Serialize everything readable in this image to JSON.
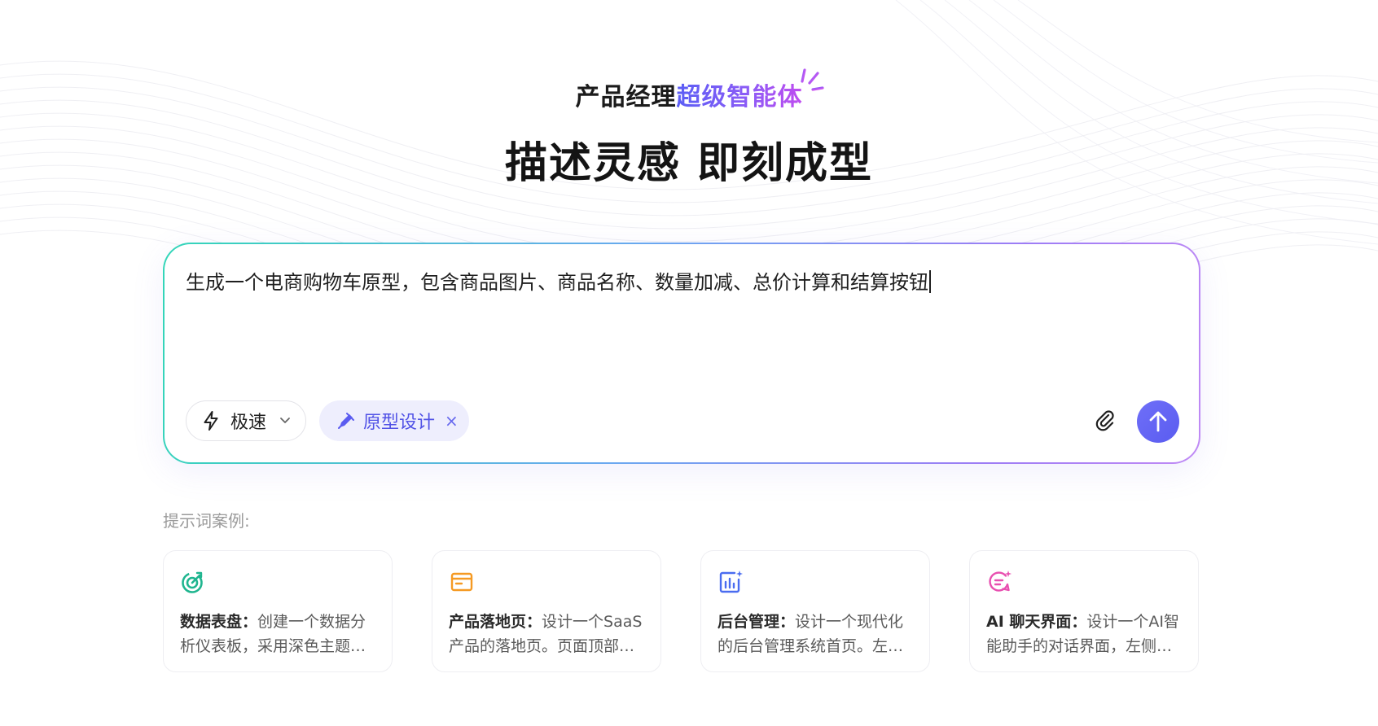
{
  "hero": {
    "subtitle_plain": "产品经理",
    "subtitle_accent": "超级智能体",
    "title": "描述灵感 即刻成型"
  },
  "prompt": {
    "text": "生成一个电商购物车原型，包含商品图片、商品名称、数量加减、总价计算和结算按钮",
    "mode_label": "极速",
    "tag_label": "原型设计",
    "tag_close": "×"
  },
  "examples": {
    "label": "提示词案例:",
    "cards": [
      {
        "title": "数据表盘",
        "separator": "：",
        "line1": "创建一个数据分",
        "line2": "析仪表板，采用深色主题…",
        "icon": "dashboard-gauge-icon",
        "color": "#1fb58f"
      },
      {
        "title": "产品落地页",
        "separator": "：",
        "line1": "设计一个SaaS",
        "line2": "产品的落地页。页面顶部…",
        "icon": "browser-window-icon",
        "color": "#f59a23"
      },
      {
        "title": "后台管理",
        "separator": "：",
        "line1": "设计一个现代化",
        "line2": "的后台管理系统首页。左…",
        "icon": "bar-chart-sparkle-icon",
        "color": "#4a6cf0"
      },
      {
        "title": "AI 聊天界面",
        "separator": "：",
        "line1": "设计一个AI智",
        "line2": "能助手的对话界面，左侧…",
        "icon": "chat-sparkle-icon",
        "color": "#e84fb0"
      }
    ]
  },
  "colors": {
    "accent": "#5b5cf0",
    "send_button": "#6366f1",
    "tag_background": "#eeeefd"
  }
}
